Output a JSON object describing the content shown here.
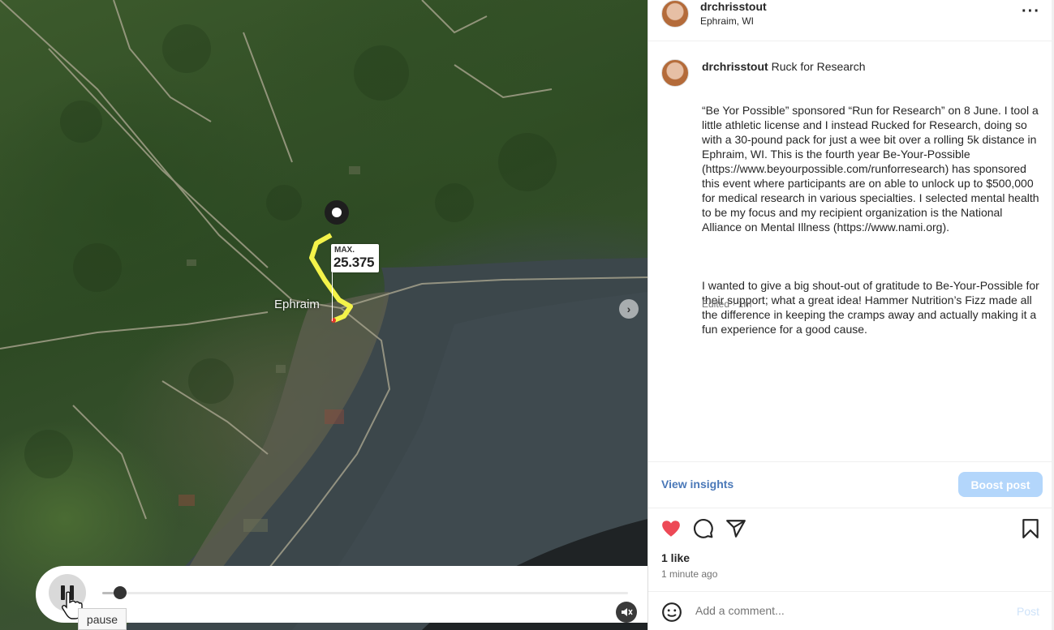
{
  "media": {
    "route_tag": {
      "line1": "MAX.",
      "line2": "25.375"
    },
    "place_label": "Ephraim",
    "tooltip": "pause",
    "progress": 0.03
  },
  "post": {
    "header": {
      "username": "drchrisstout",
      "location": "Ephraim, WI"
    },
    "caption": {
      "username": "drchrisstout",
      "title": "Ruck for Research",
      "paragraphs": [
        "“Be Yor Possible” sponsored “Run for Research” on 8 June. I tool a little athletic license and I instead Rucked for Research, doing so with a 30-pound pack for just a wee bit over a rolling 5k distance in Ephraim, WI. This is the fourth year Be-Your-Possible (https://www.beyourpossible.com/runforresearch) has sponsored this event where participants are on able to unlock up to $500,000 for medical research in various specialties. I selected mental health to be my focus and my recipient organization is the National Alliance on Mental Illness (https://www.nami.org).",
        "I wanted to give a big shout-out of gratitude to Be-Your-Possible for their support; what a great idea! Hammer Nutrition’s Fizz made all the difference in keeping the cramps away and actually making it a fun experience for a good cause."
      ],
      "meta": "Edited · 1m"
    },
    "actions": {
      "view_insights": "View insights",
      "boost_post": "Boost post",
      "likes": "1 like",
      "time_ago": "1 minute ago",
      "comment_placeholder": "Add a comment...",
      "post_label": "Post"
    },
    "icons": [
      "heart-icon",
      "comment-icon",
      "share-icon",
      "bookmark-icon",
      "emoji-icon",
      "pause-icon",
      "mute-icon",
      "chevron-right-icon"
    ],
    "colors": {
      "like": "#ed4956",
      "link": "#4a78b8",
      "boost_bg": "#b3d6fb",
      "highlight": "#f5e42a"
    }
  }
}
